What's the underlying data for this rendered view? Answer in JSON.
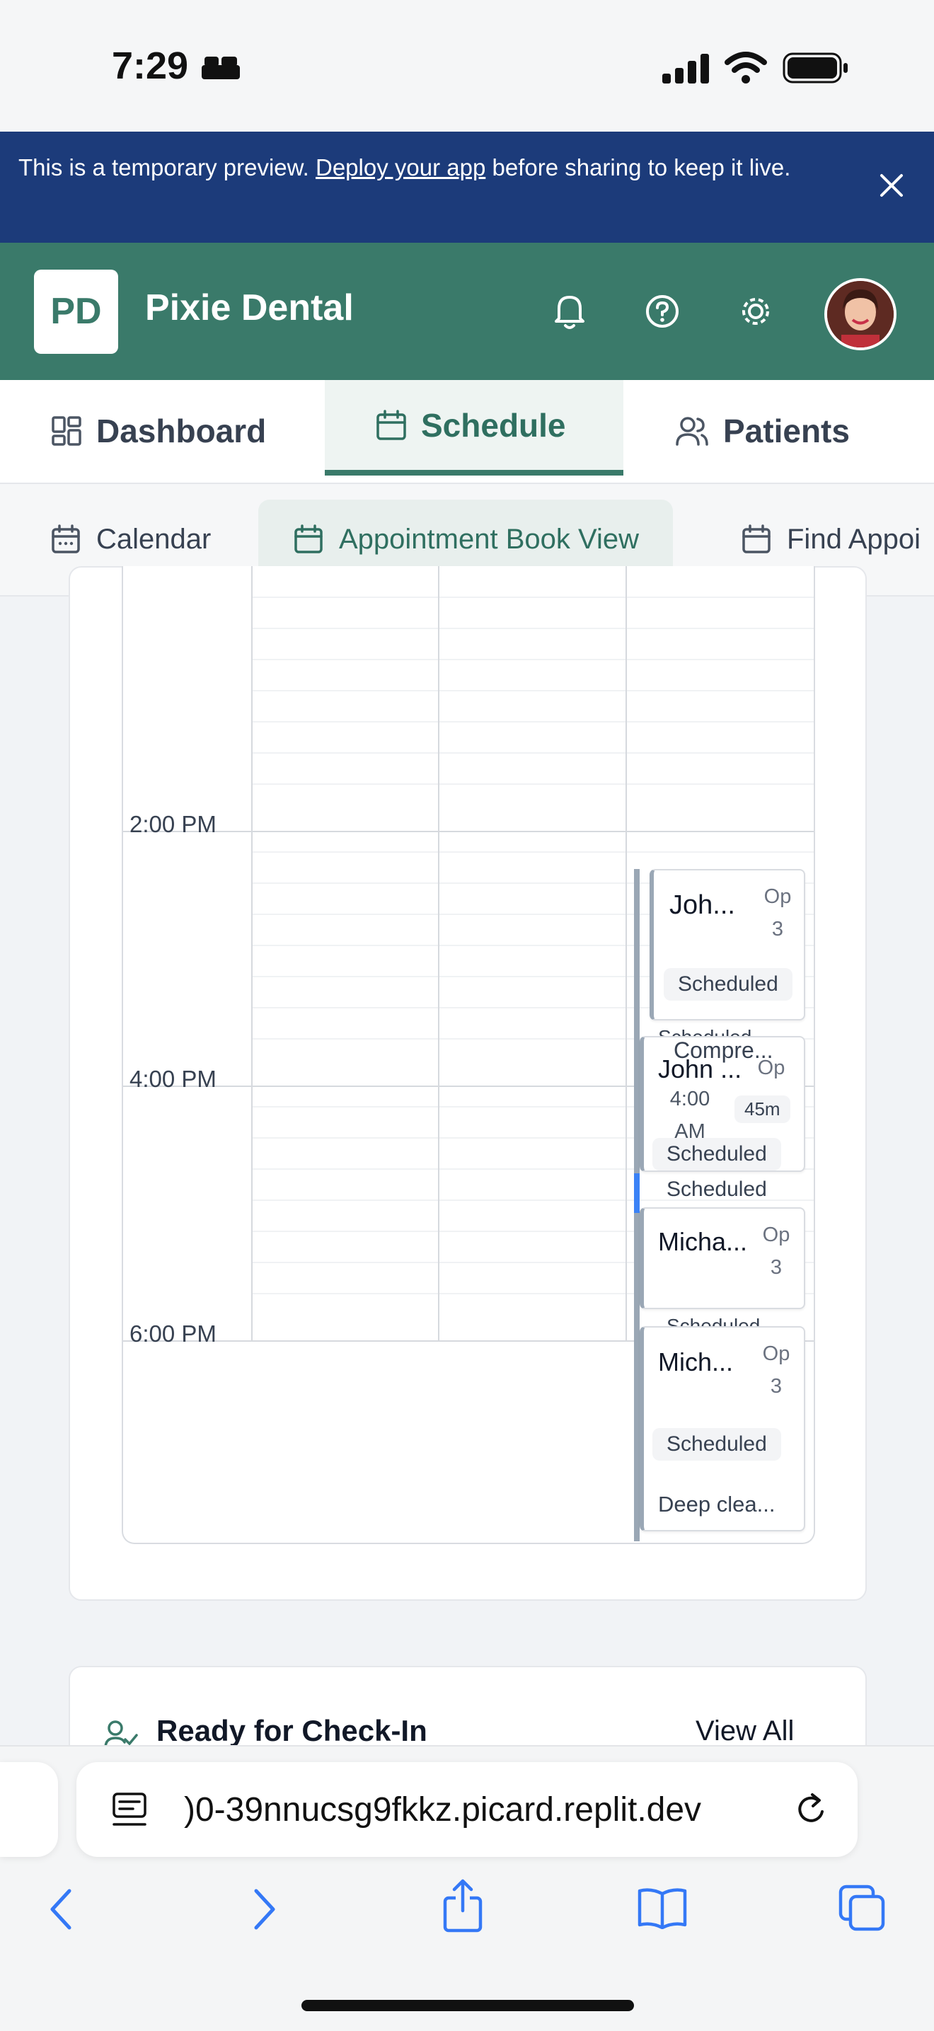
{
  "status_bar": {
    "time": "7:29"
  },
  "banner": {
    "prefix": "This is a temporary preview. ",
    "link": "Deploy your app",
    "suffix": " before sharing to keep it live."
  },
  "header": {
    "logo": "PD",
    "app_name": "Pixie Dental"
  },
  "main_nav": [
    {
      "label": "Dashboard",
      "icon": "dashboard-icon"
    },
    {
      "label": "Schedule",
      "icon": "calendar-icon",
      "active": true
    },
    {
      "label": "Patients",
      "icon": "users-icon"
    }
  ],
  "sub_nav": [
    {
      "label": "Calendar",
      "icon": "calendar-icon"
    },
    {
      "label": "Appointment Book View",
      "icon": "calendar-icon",
      "active": true
    },
    {
      "label": "Find Appoi",
      "icon": "calendar-icon"
    }
  ],
  "calendar": {
    "time_labels": [
      "2:00 PM",
      "4:00 PM",
      "6:00 PM"
    ],
    "appointments": [
      {
        "name": "Joh...",
        "op": "Op 3",
        "status": "Scheduled",
        "under": "Scheduled"
      },
      {
        "name": "John ...",
        "op": "Op",
        "peek": "Compre...",
        "time": "4:00 AM",
        "duration": "45m",
        "status": "Scheduled",
        "under": "Scheduled"
      },
      {
        "name": "Micha...",
        "op": "Op 3",
        "under": "Scheduled"
      },
      {
        "name": "Mich...",
        "op": "Op 3",
        "status": "Scheduled",
        "note": "Deep clea..."
      }
    ]
  },
  "checkin": {
    "title": "Ready for Check-In",
    "view_all": "View All"
  },
  "safari": {
    "url": ")0-39nnucsg9fkkz.picard.replit.dev"
  },
  "colors": {
    "brand": "#3a7a6a",
    "banner": "#1c3b7a"
  }
}
